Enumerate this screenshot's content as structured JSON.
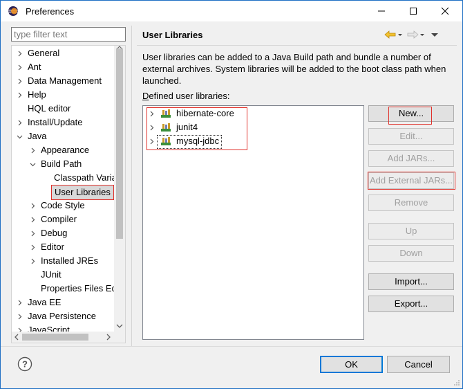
{
  "window": {
    "title": "Preferences"
  },
  "filter": {
    "placeholder": "type filter text"
  },
  "tree": [
    {
      "label": "General",
      "arrow": "right"
    },
    {
      "label": "Ant",
      "arrow": "right"
    },
    {
      "label": "Data Management",
      "arrow": "right"
    },
    {
      "label": "Help",
      "arrow": "right"
    },
    {
      "label": "HQL editor",
      "arrow": "none"
    },
    {
      "label": "Install/Update",
      "arrow": "right"
    },
    {
      "label": "Java",
      "arrow": "down"
    },
    {
      "label": "Appearance",
      "arrow": "right"
    },
    {
      "label": "Build Path",
      "arrow": "down"
    },
    {
      "label": "Classpath Varia",
      "arrow": "none"
    },
    {
      "label": "User Libraries",
      "arrow": "none",
      "selected": true
    },
    {
      "label": "Code Style",
      "arrow": "right"
    },
    {
      "label": "Compiler",
      "arrow": "right"
    },
    {
      "label": "Debug",
      "arrow": "right"
    },
    {
      "label": "Editor",
      "arrow": "right"
    },
    {
      "label": "Installed JREs",
      "arrow": "right"
    },
    {
      "label": "JUnit",
      "arrow": "none"
    },
    {
      "label": "Properties Files Ed",
      "arrow": "none"
    },
    {
      "label": "Java EE",
      "arrow": "right"
    },
    {
      "label": "Java Persistence",
      "arrow": "right"
    },
    {
      "label": "JavaScript",
      "arrow": "right"
    }
  ],
  "page": {
    "title": "User Libraries",
    "description": "User libraries can be added to a Java Build path and bundle a number of external archives. System libraries will be added to the boot class path when launched.",
    "defined_label": "Defined user libraries:"
  },
  "libraries": [
    "hibernate-core",
    "junit4",
    "mysql-jdbc"
  ],
  "buttons": {
    "new": "New...",
    "edit": "Edit...",
    "add_jars": "Add JARs...",
    "add_external_jars": "Add External JARs...",
    "remove": "Remove",
    "up": "Up",
    "down": "Down",
    "import": "Import...",
    "export": "Export..."
  },
  "dialog": {
    "ok": "OK",
    "cancel": "Cancel"
  },
  "colors": {
    "accent": "#0078d7",
    "highlight_box": "#e0302a",
    "library_icon": "#c89a2a"
  }
}
